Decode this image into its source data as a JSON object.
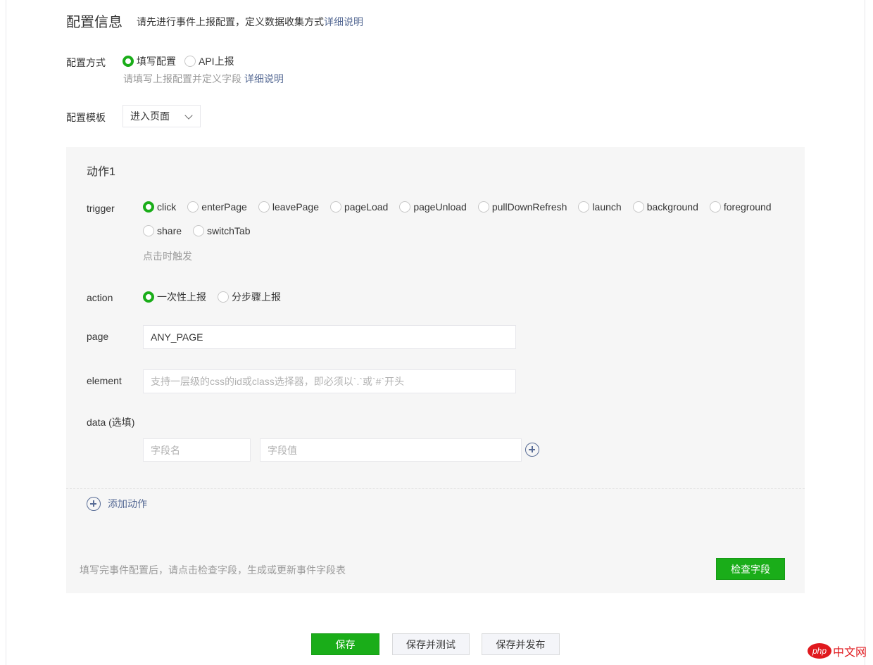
{
  "header": {
    "title": "配置信息",
    "desc": "请先进行事件上报配置，定义数据收集方式",
    "desc_link": "详细说明"
  },
  "config_method": {
    "label": "配置方式",
    "options": [
      "填写配置",
      "API上报"
    ],
    "selected": "填写配置",
    "hint": "请填写上报配置并定义字段",
    "hint_link": "详细说明"
  },
  "config_template": {
    "label": "配置模板",
    "value": "进入页面"
  },
  "action_panel": {
    "title": "动作1",
    "trigger": {
      "label": "trigger",
      "options_row1": [
        "click",
        "enterPage",
        "leavePage",
        "pageLoad",
        "pageUnload",
        "pullDownRefresh",
        "launch",
        "background",
        "foreground"
      ],
      "options_row2": [
        "share",
        "switchTab"
      ],
      "selected": "click",
      "hint": "点击时触发"
    },
    "action": {
      "label": "action",
      "options": [
        "一次性上报",
        "分步骤上报"
      ],
      "selected": "一次性上报"
    },
    "page": {
      "label": "page",
      "value": "ANY_PAGE"
    },
    "element": {
      "label": "element",
      "placeholder": "支持一层级的css的id或class选择器，即必须以`.`或`#`开头"
    },
    "data": {
      "label": "data (选填)",
      "name_placeholder": "字段名",
      "value_placeholder": "字段值"
    },
    "add_action_label": "添加动作",
    "footer_hint": "填写完事件配置后，请点击检查字段，生成或更新事件字段表",
    "check_button": "检查字段"
  },
  "bottom_buttons": {
    "save": "保存",
    "save_test": "保存并测试",
    "save_publish": "保存并发布"
  },
  "watermark": {
    "logo": "php",
    "text": "中文网"
  },
  "colors": {
    "primary_green": "#1aad19",
    "link_blue": "#576b95",
    "panel_bg": "#f6f6f6"
  }
}
